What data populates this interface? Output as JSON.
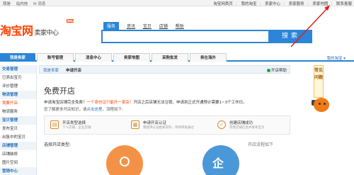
{
  "topbar": {
    "left": [
      "我是",
      "站内信",
      "消息"
    ],
    "right": [
      "淘宝网首页",
      "我的淘宝",
      "卖家中心",
      "卖家服务",
      "卖家地图",
      "联系客服"
    ]
  },
  "header": {
    "logo_main": "淘宝网",
    "logo_sub": "卖家中心",
    "logo_tag": "Beta",
    "search_tabs": [
      "服务",
      "资讯",
      "宝贝",
      "店铺",
      "帮助"
    ],
    "search_button": "搜索"
  },
  "nav": {
    "items": [
      "我是卖家",
      "账号管理",
      "消息中心",
      "卖家地图",
      "采购批发",
      "卖在海外"
    ],
    "my_taobao": "我的淘宝"
  },
  "sidebar": {
    "rows": [
      {
        "label": "交易管理",
        "type": "head"
      },
      {
        "label": "已卖出宝贝",
        "type": "item"
      },
      {
        "label": "评价管理",
        "type": "item"
      },
      {
        "label": "物流管理",
        "type": "head"
      },
      {
        "label": "我要开店",
        "type": "cur"
      },
      {
        "label": "物流服务",
        "type": "item"
      },
      {
        "label": "宝贝管理",
        "type": "head"
      },
      {
        "label": "发布宝贝",
        "type": "item"
      },
      {
        "label": "出售中的宝贝",
        "type": "item"
      },
      {
        "label": "店铺管理",
        "type": "head"
      },
      {
        "label": "店铺装修",
        "type": "item"
      },
      {
        "label": "图片空间",
        "type": "item"
      },
      {
        "label": "营销中心",
        "type": "head"
      }
    ]
  },
  "content": {
    "crumb_root": "我是卖家",
    "crumb_current": "申请开店",
    "help": "开店帮助",
    "title": "免费开店",
    "intro1_pre": "申请淘宝店铺完全免费！",
    "intro1_hl": "一个身份证只能开一家店！",
    "intro1_post": "开店之后店铺无法注销，申请到正式开通预计需要1~3个工作日。",
    "intro2_pre": "您了解更多开店知识，请点击这里，",
    "intro2_link": "点击这里",
    "intro2_post": "流程如下:",
    "steps": [
      {
        "title": "开店类型选择",
        "desc": "个人店铺，企业店铺"
      },
      {
        "title": "申请开店认证",
        "desc": "需提供认证相关资料，等待审核通过"
      },
      {
        "title": "创建店铺成功",
        "desc": "完善店铺信息并发布宝贝"
      }
    ],
    "choose_label": "选择开店类型:",
    "flow_label": "开店流程如下"
  },
  "sidehelp": "常见问题"
}
